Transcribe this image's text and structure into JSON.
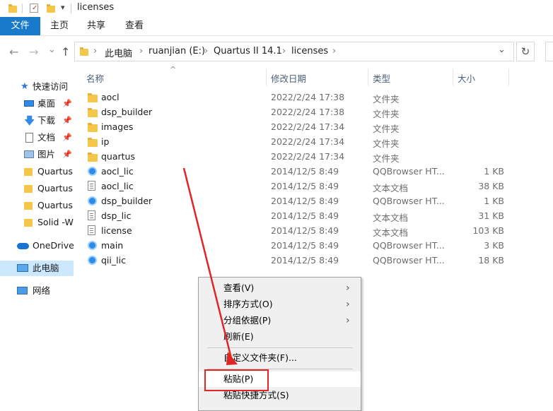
{
  "window": {
    "title": "licenses"
  },
  "ribbon": {
    "file_tab": "文件",
    "tabs": [
      "主页",
      "共享",
      "查看"
    ]
  },
  "nav": {
    "back": "←",
    "forward": "→",
    "recent": "⌄",
    "up": "↑"
  },
  "address": {
    "crumbs": [
      "此电脑",
      "ruanjian (E:)",
      "Quartus II 14.1",
      "licenses"
    ],
    "dropdown": "⌄",
    "refresh": "↻"
  },
  "sidebar": {
    "items": [
      {
        "label": "快速访问",
        "icon": "star-icon",
        "pinned": false
      },
      {
        "label": "桌面",
        "icon": "desktop-icon",
        "pinned": true
      },
      {
        "label": "下载",
        "icon": "download-icon",
        "pinned": true
      },
      {
        "label": "文档",
        "icon": "document-icon",
        "pinned": true
      },
      {
        "label": "图片",
        "icon": "picture-icon",
        "pinned": true
      },
      {
        "label": "Quartus",
        "icon": "folder-icon",
        "pinned": false
      },
      {
        "label": "Quartus",
        "icon": "folder-icon",
        "pinned": false
      },
      {
        "label": "Quartus",
        "icon": "folder-icon",
        "pinned": false
      },
      {
        "label": "Solid -W",
        "icon": "folder-icon",
        "pinned": false
      },
      {
        "label": "OneDrive",
        "icon": "cloud-icon",
        "pinned": false
      },
      {
        "label": "此电脑",
        "icon": "computer-icon",
        "pinned": false,
        "selected": true
      },
      {
        "label": "网络",
        "icon": "network-icon",
        "pinned": false
      }
    ]
  },
  "columns": {
    "name": "名称",
    "date": "修改日期",
    "type": "类型",
    "size": "大小"
  },
  "files": [
    {
      "name": "aocl",
      "date": "2022/2/24 17:38",
      "type": "文件夹",
      "size": "",
      "icon": "folder"
    },
    {
      "name": "dsp_builder",
      "date": "2022/2/24 17:38",
      "type": "文件夹",
      "size": "",
      "icon": "folder"
    },
    {
      "name": "images",
      "date": "2022/2/24 17:34",
      "type": "文件夹",
      "size": "",
      "icon": "folder"
    },
    {
      "name": "ip",
      "date": "2022/2/24 17:34",
      "type": "文件夹",
      "size": "",
      "icon": "folder"
    },
    {
      "name": "quartus",
      "date": "2022/2/24 17:34",
      "type": "文件夹",
      "size": "",
      "icon": "folder"
    },
    {
      "name": "aocl_lic",
      "date": "2014/12/5 8:49",
      "type": "QQBrowser HT...",
      "size": "1 KB",
      "icon": "qqbrowser"
    },
    {
      "name": "aocl_lic",
      "date": "2014/12/5 8:49",
      "type": "文本文档",
      "size": "38 KB",
      "icon": "text"
    },
    {
      "name": "dsp_builder",
      "date": "2014/12/5 8:49",
      "type": "QQBrowser HT...",
      "size": "1 KB",
      "icon": "qqbrowser"
    },
    {
      "name": "dsp_lic",
      "date": "2014/12/5 8:49",
      "type": "文本文档",
      "size": "31 KB",
      "icon": "text"
    },
    {
      "name": "license",
      "date": "2014/12/5 8:49",
      "type": "文本文档",
      "size": "103 KB",
      "icon": "text"
    },
    {
      "name": "main",
      "date": "2014/12/5 8:49",
      "type": "QQBrowser HT...",
      "size": "3 KB",
      "icon": "qqbrowser"
    },
    {
      "name": "qii_lic",
      "date": "2014/12/5 8:49",
      "type": "QQBrowser HT...",
      "size": "18 KB",
      "icon": "qqbrowser"
    }
  ],
  "context_menu": {
    "view": "查看(V)",
    "sort": "排序方式(O)",
    "group": "分组依据(P)",
    "refresh": "刷新(E)",
    "customize": "自定义文件夹(F)...",
    "paste": "粘贴(P)",
    "paste_shortcut": "粘贴快捷方式(S)",
    "submenu_arrow": "›"
  },
  "colors": {
    "accent": "#1979ca",
    "selection": "#cce8ff",
    "annotation": "#e02525"
  }
}
